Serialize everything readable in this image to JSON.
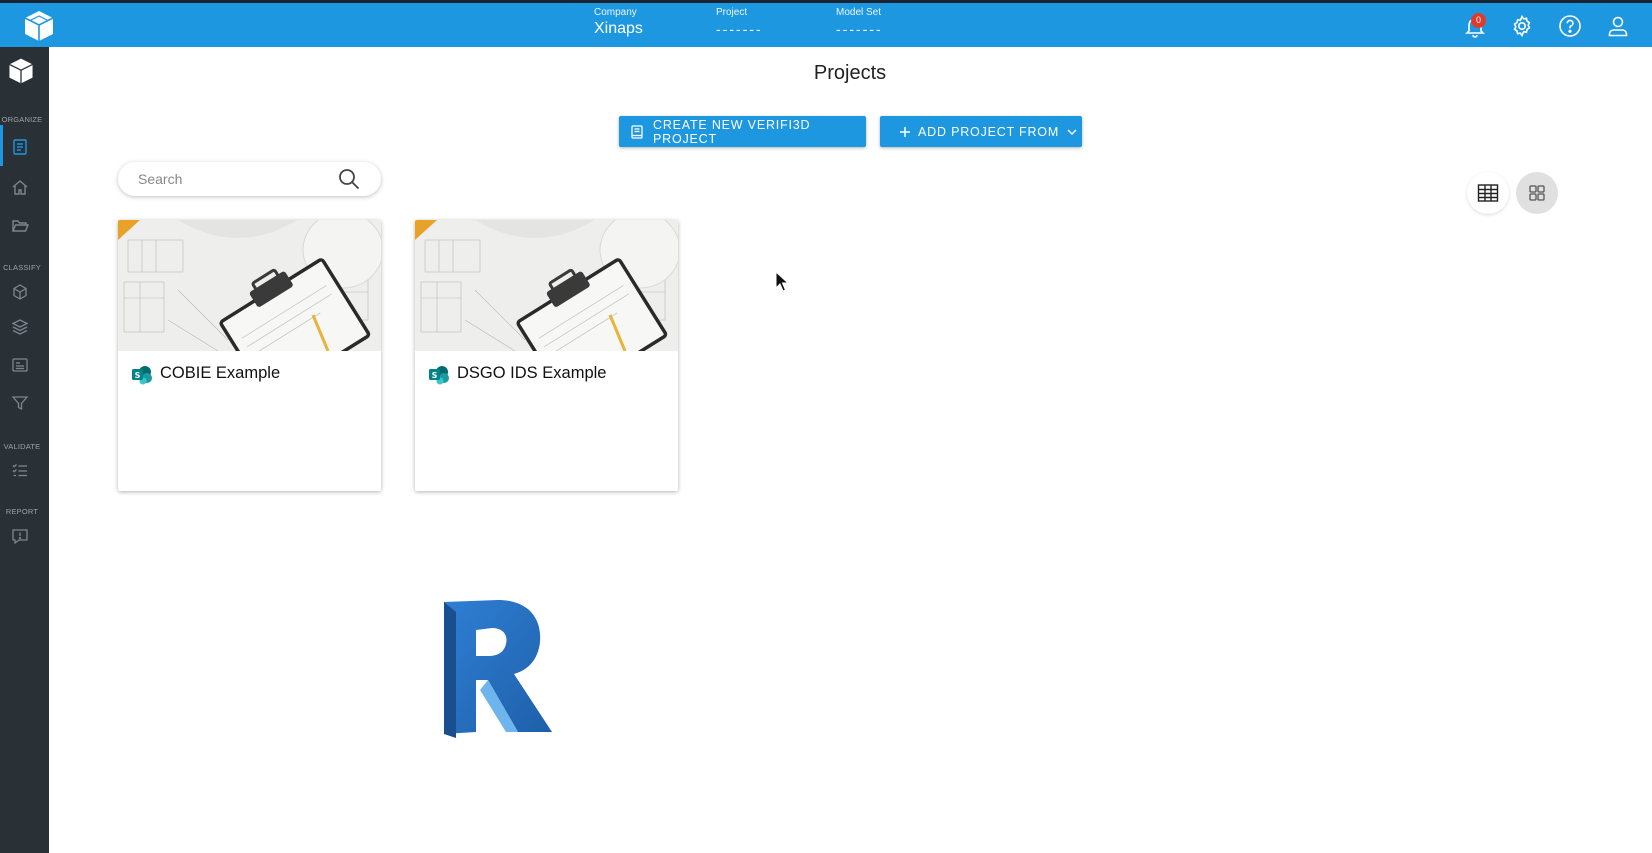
{
  "header": {
    "company_label": "Company",
    "company_value": "Xinaps",
    "project_label": "Project",
    "project_value": "-------",
    "model_set_label": "Model Set",
    "model_set_value": "-------",
    "notification_count": "0"
  },
  "sidebar": {
    "sections": {
      "organize": "ORGANIZE",
      "classify": "CLASSIFY",
      "validate": "VALIDATE",
      "report": "REPORT"
    }
  },
  "main": {
    "title": "Projects",
    "create_button": "CREATE NEW VERIFI3D PROJECT",
    "add_button": "ADD PROJECT FROM",
    "search_placeholder": "Search",
    "projects": [
      {
        "name": "COBIE Example",
        "source_icon": "sharepoint-icon"
      },
      {
        "name": "DSGO IDS Example",
        "source_icon": "sharepoint-icon"
      }
    ]
  },
  "colors": {
    "topbar": "#1d97e0",
    "sidebar": "#2a3136",
    "badge": "#e03a2e"
  }
}
